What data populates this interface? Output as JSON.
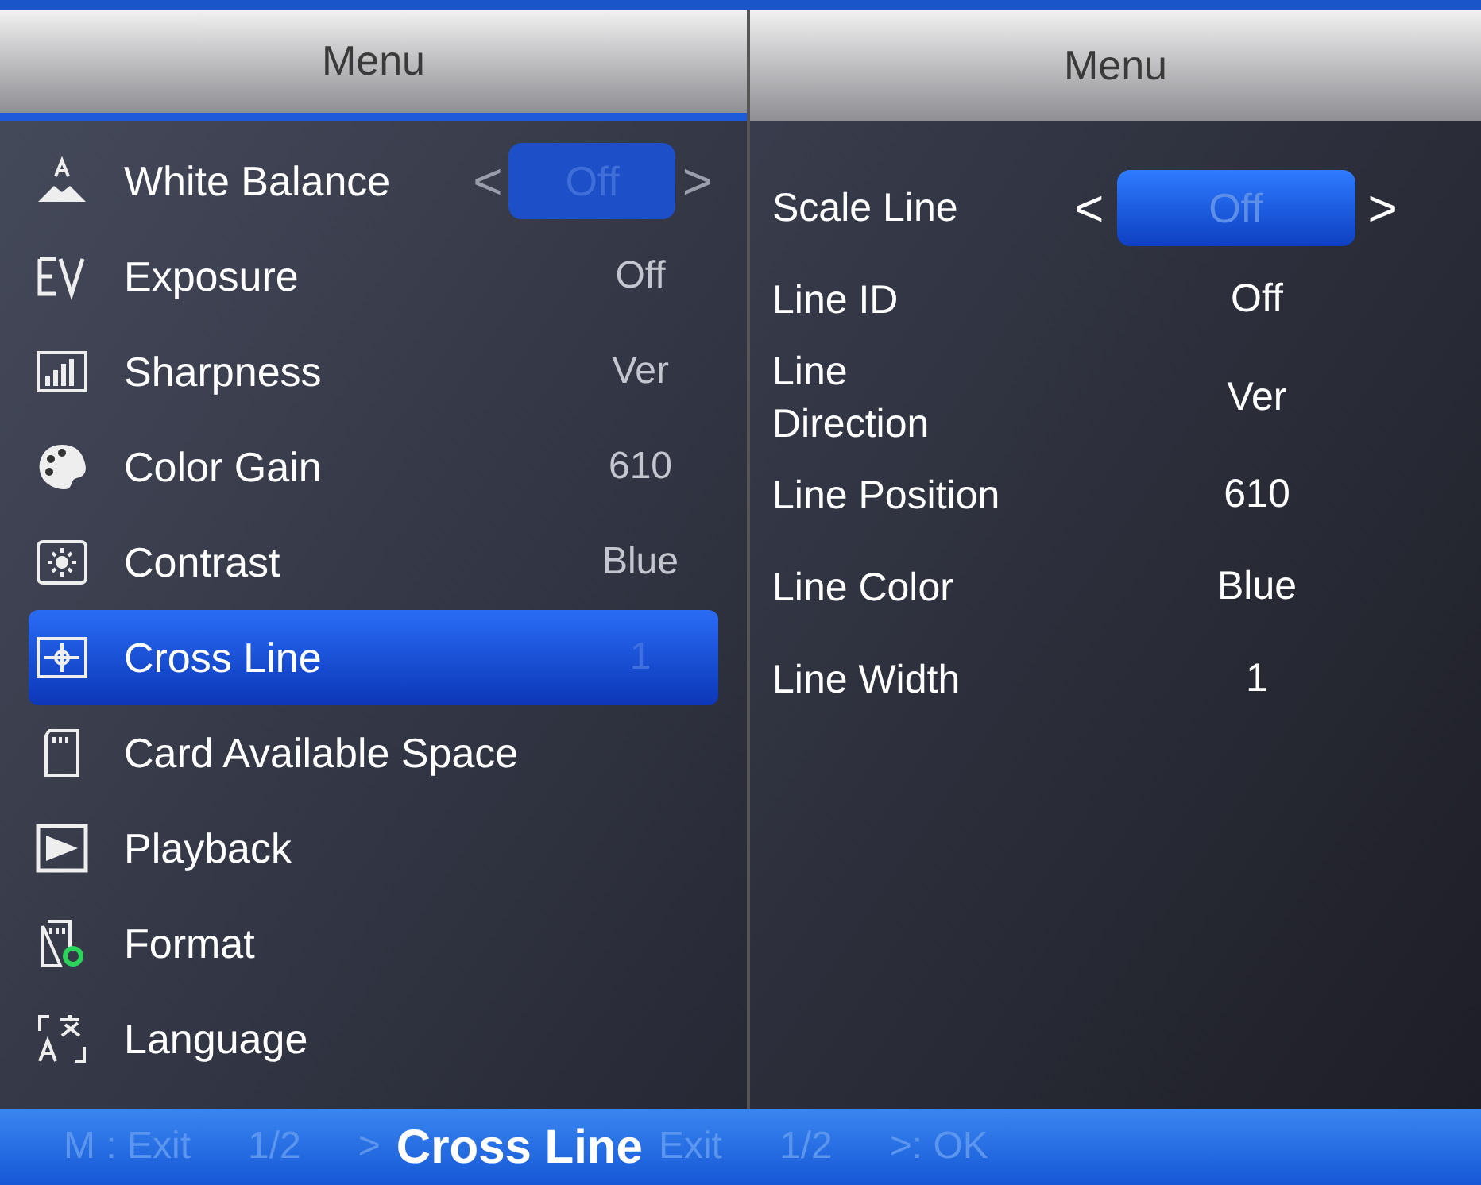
{
  "left_panel": {
    "title": "Menu",
    "items": [
      {
        "label": "White Balance",
        "selected": false
      },
      {
        "label": "Exposure",
        "selected": false
      },
      {
        "label": "Sharpness",
        "selected": false
      },
      {
        "label": "Color Gain",
        "selected": false
      },
      {
        "label": "Contrast",
        "selected": false
      },
      {
        "label": "Cross Line",
        "selected": true
      },
      {
        "label": "Card Available Space",
        "selected": false
      },
      {
        "label": "Playback",
        "selected": false
      },
      {
        "label": "Format",
        "selected": false
      },
      {
        "label": "Language",
        "selected": false
      }
    ],
    "ghost_values": [
      {
        "kind": "selector",
        "prev": "<",
        "value": "Off",
        "next": ">"
      },
      {
        "kind": "value",
        "value": "Off"
      },
      {
        "kind": "value",
        "value": "Ver"
      },
      {
        "kind": "value",
        "value": "610"
      },
      {
        "kind": "value",
        "value": "Blue"
      },
      {
        "kind": "value",
        "value": "1"
      }
    ]
  },
  "right_panel": {
    "title": "Menu",
    "settings": [
      {
        "kind": "selector",
        "label": "Scale Line",
        "prev": "<",
        "value": "Off",
        "next": ">"
      },
      {
        "kind": "value",
        "label": "Line ID",
        "value": "Off"
      },
      {
        "kind": "value",
        "label": "Line\nDirection",
        "value": "Ver"
      },
      {
        "kind": "value",
        "label": "Line Position",
        "value": "610"
      },
      {
        "kind": "value",
        "label": "Line Color",
        "value": "Blue"
      },
      {
        "kind": "value",
        "label": "Line Width",
        "value": "1"
      }
    ]
  },
  "footer": {
    "hints": [
      "M : Exit",
      "1/2",
      ">"
    ],
    "title": "Cross Line",
    "hints_after": [
      "Exit",
      "1/2",
      ">: OK"
    ]
  }
}
